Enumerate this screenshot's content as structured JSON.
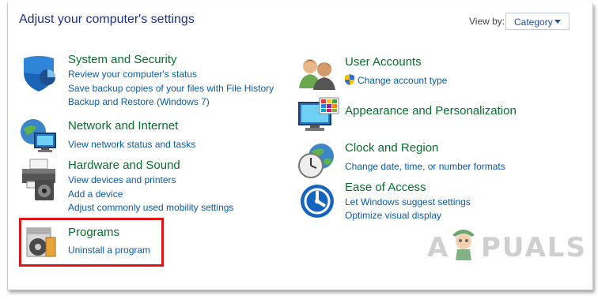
{
  "header": {
    "title": "Adjust your computer's settings",
    "view_by_label": "View by:",
    "view_by_value": "Category"
  },
  "categories": [
    {
      "icon": "shield-icon",
      "title": "System and Security",
      "links": [
        "Review your computer's status",
        "Save backup copies of your files with File History",
        "Backup and Restore (Windows 7)"
      ]
    },
    {
      "icon": "network-globe-icon",
      "title": "Network and Internet",
      "links": [
        "View network status and tasks"
      ]
    },
    {
      "icon": "printer-icon",
      "title": "Hardware and Sound",
      "links": [
        "View devices and printers",
        "Add a device",
        "Adjust commonly used mobility settings"
      ]
    },
    {
      "icon": "programs-disc-icon",
      "title": "Programs",
      "links": [
        "Uninstall a program"
      ]
    },
    {
      "icon": "users-icon",
      "title": "User Accounts",
      "links": [
        "Change account type"
      ]
    },
    {
      "icon": "monitor-palette-icon",
      "title": "Appearance and Personalization",
      "links": []
    },
    {
      "icon": "clock-globe-icon",
      "title": "Clock and Region",
      "links": [
        "Change date, time, or number formats"
      ]
    },
    {
      "icon": "ease-of-access-icon",
      "title": "Ease of Access",
      "links": [
        "Let Windows suggest settings",
        "Optimize visual display"
      ]
    }
  ],
  "watermark": {
    "left": "A",
    "right": "PUALS"
  },
  "colors": {
    "title_green": "#0a6d2e",
    "link_blue": "#0a5aa8",
    "heading_blue": "#1e3287",
    "highlight_red": "#e01515"
  }
}
